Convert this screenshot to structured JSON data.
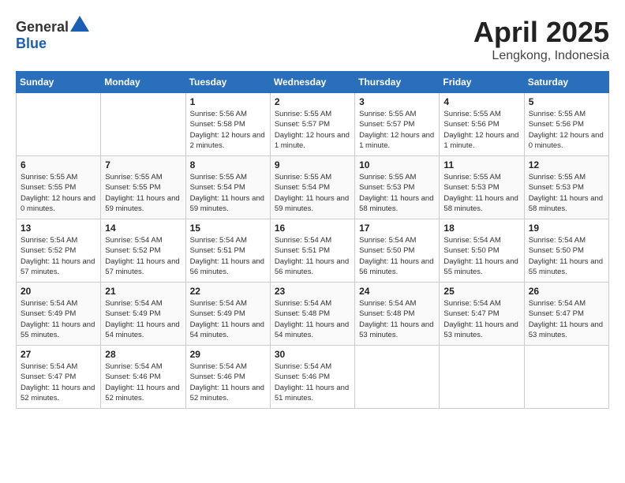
{
  "header": {
    "logo_general": "General",
    "logo_blue": "Blue",
    "title": "April 2025",
    "subtitle": "Lengkong, Indonesia"
  },
  "weekdays": [
    "Sunday",
    "Monday",
    "Tuesday",
    "Wednesday",
    "Thursday",
    "Friday",
    "Saturday"
  ],
  "weeks": [
    [
      {
        "day": "",
        "sunrise": "",
        "sunset": "",
        "daylight": ""
      },
      {
        "day": "",
        "sunrise": "",
        "sunset": "",
        "daylight": ""
      },
      {
        "day": "1",
        "sunrise": "Sunrise: 5:56 AM",
        "sunset": "Sunset: 5:58 PM",
        "daylight": "Daylight: 12 hours and 2 minutes."
      },
      {
        "day": "2",
        "sunrise": "Sunrise: 5:55 AM",
        "sunset": "Sunset: 5:57 PM",
        "daylight": "Daylight: 12 hours and 1 minute."
      },
      {
        "day": "3",
        "sunrise": "Sunrise: 5:55 AM",
        "sunset": "Sunset: 5:57 PM",
        "daylight": "Daylight: 12 hours and 1 minute."
      },
      {
        "day": "4",
        "sunrise": "Sunrise: 5:55 AM",
        "sunset": "Sunset: 5:56 PM",
        "daylight": "Daylight: 12 hours and 1 minute."
      },
      {
        "day": "5",
        "sunrise": "Sunrise: 5:55 AM",
        "sunset": "Sunset: 5:56 PM",
        "daylight": "Daylight: 12 hours and 0 minutes."
      }
    ],
    [
      {
        "day": "6",
        "sunrise": "Sunrise: 5:55 AM",
        "sunset": "Sunset: 5:55 PM",
        "daylight": "Daylight: 12 hours and 0 minutes."
      },
      {
        "day": "7",
        "sunrise": "Sunrise: 5:55 AM",
        "sunset": "Sunset: 5:55 PM",
        "daylight": "Daylight: 11 hours and 59 minutes."
      },
      {
        "day": "8",
        "sunrise": "Sunrise: 5:55 AM",
        "sunset": "Sunset: 5:54 PM",
        "daylight": "Daylight: 11 hours and 59 minutes."
      },
      {
        "day": "9",
        "sunrise": "Sunrise: 5:55 AM",
        "sunset": "Sunset: 5:54 PM",
        "daylight": "Daylight: 11 hours and 59 minutes."
      },
      {
        "day": "10",
        "sunrise": "Sunrise: 5:55 AM",
        "sunset": "Sunset: 5:53 PM",
        "daylight": "Daylight: 11 hours and 58 minutes."
      },
      {
        "day": "11",
        "sunrise": "Sunrise: 5:55 AM",
        "sunset": "Sunset: 5:53 PM",
        "daylight": "Daylight: 11 hours and 58 minutes."
      },
      {
        "day": "12",
        "sunrise": "Sunrise: 5:55 AM",
        "sunset": "Sunset: 5:53 PM",
        "daylight": "Daylight: 11 hours and 58 minutes."
      }
    ],
    [
      {
        "day": "13",
        "sunrise": "Sunrise: 5:54 AM",
        "sunset": "Sunset: 5:52 PM",
        "daylight": "Daylight: 11 hours and 57 minutes."
      },
      {
        "day": "14",
        "sunrise": "Sunrise: 5:54 AM",
        "sunset": "Sunset: 5:52 PM",
        "daylight": "Daylight: 11 hours and 57 minutes."
      },
      {
        "day": "15",
        "sunrise": "Sunrise: 5:54 AM",
        "sunset": "Sunset: 5:51 PM",
        "daylight": "Daylight: 11 hours and 56 minutes."
      },
      {
        "day": "16",
        "sunrise": "Sunrise: 5:54 AM",
        "sunset": "Sunset: 5:51 PM",
        "daylight": "Daylight: 11 hours and 56 minutes."
      },
      {
        "day": "17",
        "sunrise": "Sunrise: 5:54 AM",
        "sunset": "Sunset: 5:50 PM",
        "daylight": "Daylight: 11 hours and 56 minutes."
      },
      {
        "day": "18",
        "sunrise": "Sunrise: 5:54 AM",
        "sunset": "Sunset: 5:50 PM",
        "daylight": "Daylight: 11 hours and 55 minutes."
      },
      {
        "day": "19",
        "sunrise": "Sunrise: 5:54 AM",
        "sunset": "Sunset: 5:50 PM",
        "daylight": "Daylight: 11 hours and 55 minutes."
      }
    ],
    [
      {
        "day": "20",
        "sunrise": "Sunrise: 5:54 AM",
        "sunset": "Sunset: 5:49 PM",
        "daylight": "Daylight: 11 hours and 55 minutes."
      },
      {
        "day": "21",
        "sunrise": "Sunrise: 5:54 AM",
        "sunset": "Sunset: 5:49 PM",
        "daylight": "Daylight: 11 hours and 54 minutes."
      },
      {
        "day": "22",
        "sunrise": "Sunrise: 5:54 AM",
        "sunset": "Sunset: 5:49 PM",
        "daylight": "Daylight: 11 hours and 54 minutes."
      },
      {
        "day": "23",
        "sunrise": "Sunrise: 5:54 AM",
        "sunset": "Sunset: 5:48 PM",
        "daylight": "Daylight: 11 hours and 54 minutes."
      },
      {
        "day": "24",
        "sunrise": "Sunrise: 5:54 AM",
        "sunset": "Sunset: 5:48 PM",
        "daylight": "Daylight: 11 hours and 53 minutes."
      },
      {
        "day": "25",
        "sunrise": "Sunrise: 5:54 AM",
        "sunset": "Sunset: 5:47 PM",
        "daylight": "Daylight: 11 hours and 53 minutes."
      },
      {
        "day": "26",
        "sunrise": "Sunrise: 5:54 AM",
        "sunset": "Sunset: 5:47 PM",
        "daylight": "Daylight: 11 hours and 53 minutes."
      }
    ],
    [
      {
        "day": "27",
        "sunrise": "Sunrise: 5:54 AM",
        "sunset": "Sunset: 5:47 PM",
        "daylight": "Daylight: 11 hours and 52 minutes."
      },
      {
        "day": "28",
        "sunrise": "Sunrise: 5:54 AM",
        "sunset": "Sunset: 5:46 PM",
        "daylight": "Daylight: 11 hours and 52 minutes."
      },
      {
        "day": "29",
        "sunrise": "Sunrise: 5:54 AM",
        "sunset": "Sunset: 5:46 PM",
        "daylight": "Daylight: 11 hours and 52 minutes."
      },
      {
        "day": "30",
        "sunrise": "Sunrise: 5:54 AM",
        "sunset": "Sunset: 5:46 PM",
        "daylight": "Daylight: 11 hours and 51 minutes."
      },
      {
        "day": "",
        "sunrise": "",
        "sunset": "",
        "daylight": ""
      },
      {
        "day": "",
        "sunrise": "",
        "sunset": "",
        "daylight": ""
      },
      {
        "day": "",
        "sunrise": "",
        "sunset": "",
        "daylight": ""
      }
    ]
  ]
}
